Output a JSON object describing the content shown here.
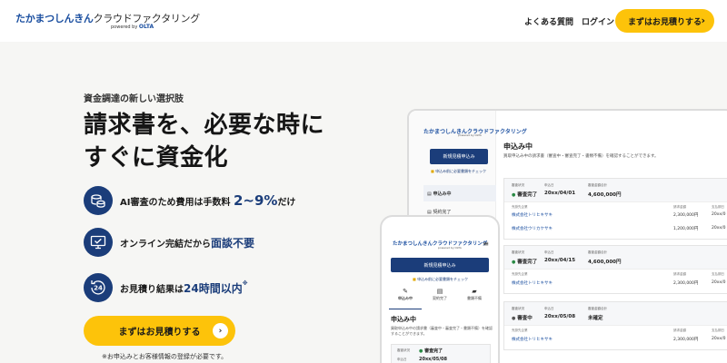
{
  "header": {
    "logo_part1": "たかまつしんきん",
    "logo_part2": "クラウドファクタリング",
    "logo_powered": "powered by",
    "logo_brand": "OLTA",
    "nav_faq": "よくある質問",
    "nav_login": "ログイン",
    "cta_label": "まずはお見積りする"
  },
  "hero": {
    "tagline": "資金調達の新しい選択肢",
    "headline_line1": "請求書を、必要な時に",
    "headline_line2": "すぐに資金化",
    "features": [
      {
        "icon": "coins-icon",
        "text": "AI審査のため費用は手数料",
        "highlight": "2~9%",
        "suffix": "だけ"
      },
      {
        "icon": "monitor-check-icon",
        "text": "オンライン完結だから",
        "highlight": "面談不要",
        "suffix": ""
      },
      {
        "icon": "clock-24-icon",
        "text": "お見積り結果は",
        "highlight": "24時間以内",
        "suffix": "※"
      }
    ],
    "cta_label": "まずはお見積りする",
    "note": "※お申込みとお客様情報の登録が必要です。"
  },
  "desktop_mock": {
    "logo": "たかまつしんきんクラウドファクタリング",
    "logo_sub": "powered by OLTA",
    "new_button": "新規見積申込み",
    "check_link": "申込み前に必要書類をチェック",
    "side_items": [
      "申込み中",
      "契約完了"
    ],
    "title": "申込み中",
    "desc": "買取申込み中の請求書（審査中・審査完了・書類不備）を確認することができます。",
    "labels": {
      "status": "審査状況",
      "apply_date": "申込日",
      "total": "審査金額合計",
      "company": "売掛先企業",
      "amount": "請求金額",
      "due": "支払期日"
    },
    "cards": [
      {
        "status": "審査完了",
        "date": "20xx/04/01",
        "total": "4,600,000円",
        "rows": [
          {
            "company": "株式会社トリヒキサキ",
            "amount": "2,300,000円",
            "due": "20xx/0"
          },
          {
            "company": "株式会社ウリカケサキ",
            "amount": "1,200,000円",
            "due": "20xx/0"
          }
        ]
      },
      {
        "status": "審査完了",
        "date": "20xx/04/15",
        "total": "4,600,000円",
        "rows": [
          {
            "company": "株式会社トリヒキサキ",
            "amount": "2,300,000円",
            "due": "20xx/0"
          }
        ]
      },
      {
        "status": "審査中",
        "date": "20xx/05/08",
        "total": "未確定",
        "rows": [
          {
            "company": "株式会社トリヒキサキ",
            "amount": "2,300,000円",
            "due": "20xx/0"
          }
        ]
      }
    ]
  },
  "phone_mock": {
    "logo": "たかまつしんきんクラウドファクタリング",
    "logo_sub": "powered by OLTA",
    "new_button": "新規見積申込み",
    "check_link": "申込み前に必要書類をチェック",
    "tabs": [
      "申込み中",
      "契約完了",
      "書類不備"
    ],
    "title": "申込み中",
    "desc": "買取申込み中の請求書（審査中・審査完了・書類不備）を確認することができます。",
    "card_status_label": "審査状況",
    "card_status": "審査完了",
    "card_date_label": "申込日",
    "card_date": "20xx/05/08"
  }
}
